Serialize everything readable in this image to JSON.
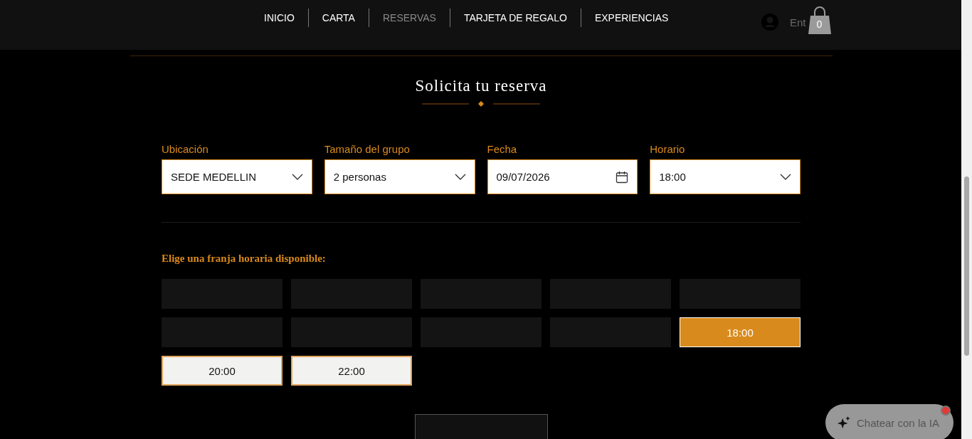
{
  "nav": {
    "items": [
      {
        "label": "INICIO",
        "selected": false
      },
      {
        "label": "CARTA",
        "selected": false
      },
      {
        "label": "RESERVAS",
        "selected": true
      },
      {
        "label": "TARJETA DE REGALO",
        "selected": false
      },
      {
        "label": "EXPERIENCIAS",
        "selected": false
      }
    ],
    "login": "Ent",
    "cart_count": "0"
  },
  "title": "Solicita tu reserva",
  "fields": [
    {
      "label": "Ubicación",
      "value": "SEDE MEDELLIN",
      "kind": "select"
    },
    {
      "label": "Tamaño del grupo",
      "value": "2 personas",
      "kind": "select"
    },
    {
      "label": "Fecha",
      "value": "09/07/2026",
      "kind": "date"
    },
    {
      "label": "Horario",
      "value": "18:00",
      "kind": "select"
    }
  ],
  "slots_heading": "Elige una franja horaria disponible:",
  "slots": [
    {
      "kind": "unavailable",
      "selected": false
    },
    {
      "kind": "unavailable",
      "selected": false
    },
    {
      "kind": "unavailable",
      "selected": false
    },
    {
      "kind": "unavailable",
      "selected": false
    },
    {
      "kind": "unavailable",
      "selected": false
    },
    {
      "kind": "unavailable",
      "selected": false
    },
    {
      "kind": "unavailable",
      "selected": false
    },
    {
      "kind": "unavailable",
      "selected": false
    },
    {
      "kind": "unavailable",
      "selected": false
    },
    {
      "kind": "time",
      "time": "18:00",
      "selected": true
    },
    {
      "kind": "time",
      "time": "20:00",
      "selected": false
    },
    {
      "kind": "time",
      "time": "22:00",
      "selected": false
    }
  ],
  "chat_button": {
    "label": "Chatear con la IA",
    "unread": true
  }
}
